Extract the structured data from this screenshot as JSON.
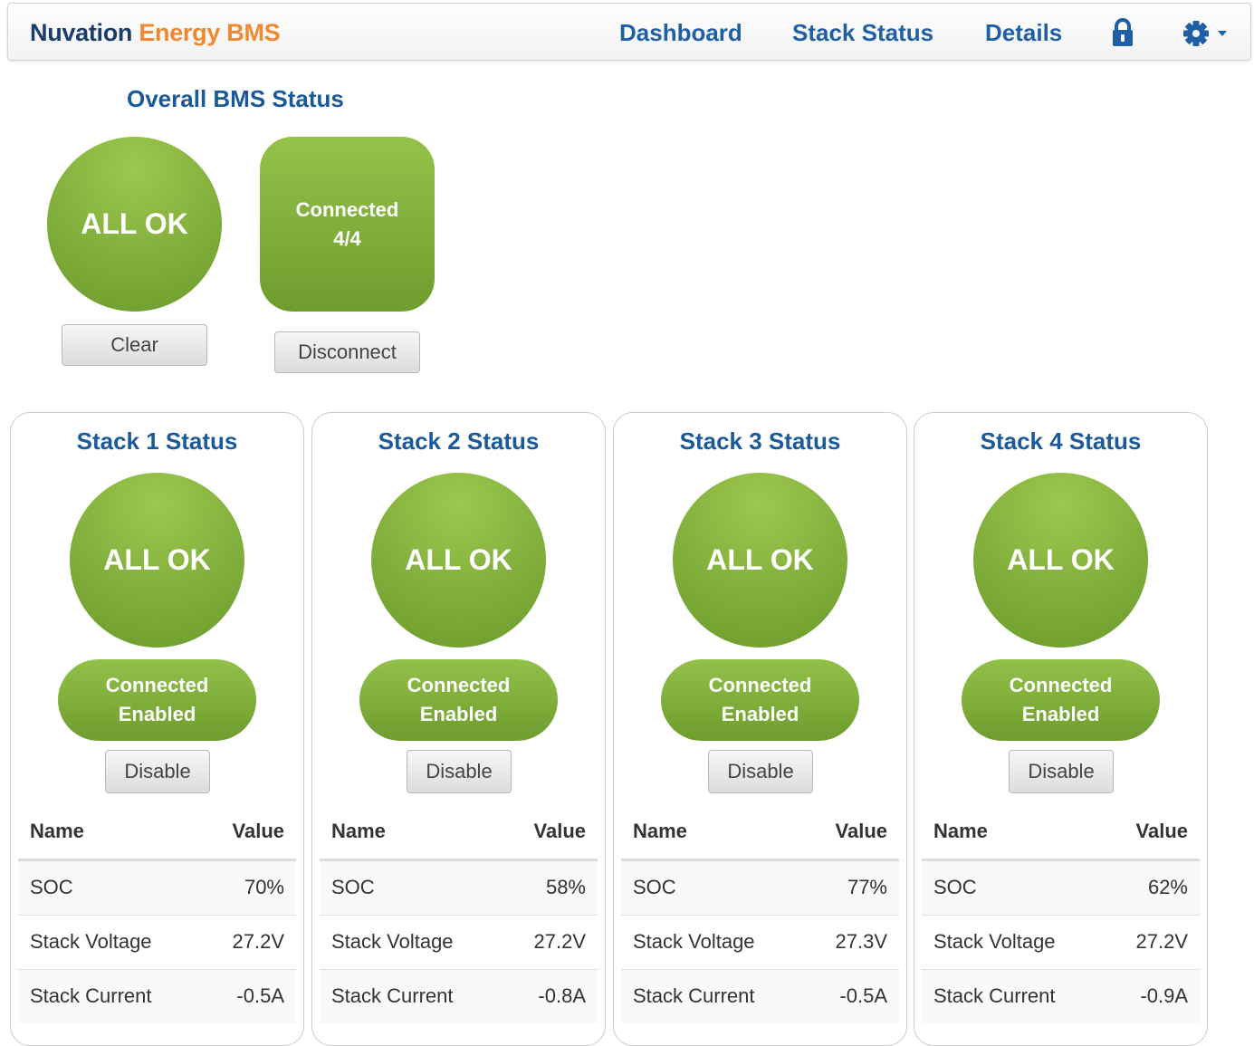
{
  "brand": {
    "part1": "Nuvation",
    "part2": "Energy BMS"
  },
  "nav": {
    "dashboard": "Dashboard",
    "stack_status": "Stack Status",
    "details": "Details",
    "lock_icon": "lock-icon",
    "settings_icon": "gear-icon"
  },
  "overall": {
    "title": "Overall BMS Status",
    "status": "ALL OK",
    "clear_label": "Clear",
    "connection_line1": "Connected",
    "connection_line2": "4/4",
    "disconnect_label": "Disconnect"
  },
  "table_headers": {
    "name": "Name",
    "value": "Value"
  },
  "stacks": [
    {
      "title": "Stack 1 Status",
      "status": "ALL OK",
      "state_line1": "Connected",
      "state_line2": "Enabled",
      "button": "Disable",
      "rows": [
        {
          "name": "SOC",
          "value": "70%"
        },
        {
          "name": "Stack Voltage",
          "value": "27.2V"
        },
        {
          "name": "Stack Current",
          "value": "-0.5A"
        }
      ]
    },
    {
      "title": "Stack 2 Status",
      "status": "ALL OK",
      "state_line1": "Connected",
      "state_line2": "Enabled",
      "button": "Disable",
      "rows": [
        {
          "name": "SOC",
          "value": "58%"
        },
        {
          "name": "Stack Voltage",
          "value": "27.2V"
        },
        {
          "name": "Stack Current",
          "value": "-0.8A"
        }
      ]
    },
    {
      "title": "Stack 3 Status",
      "status": "ALL OK",
      "state_line1": "Connected",
      "state_line2": "Enabled",
      "button": "Disable",
      "rows": [
        {
          "name": "SOC",
          "value": "77%"
        },
        {
          "name": "Stack Voltage",
          "value": "27.3V"
        },
        {
          "name": "Stack Current",
          "value": "-0.5A"
        }
      ]
    },
    {
      "title": "Stack 4 Status",
      "status": "ALL OK",
      "state_line1": "Connected",
      "state_line2": "Enabled",
      "button": "Disable",
      "rows": [
        {
          "name": "SOC",
          "value": "62%"
        },
        {
          "name": "Stack Voltage",
          "value": "27.2V"
        },
        {
          "name": "Stack Current",
          "value": "-0.9A"
        }
      ]
    }
  ],
  "colors": {
    "brand_dark": "#1a3d6d",
    "brand_accent": "#f0892d",
    "link": "#1f5fa6",
    "status_green": "#86b33f"
  }
}
